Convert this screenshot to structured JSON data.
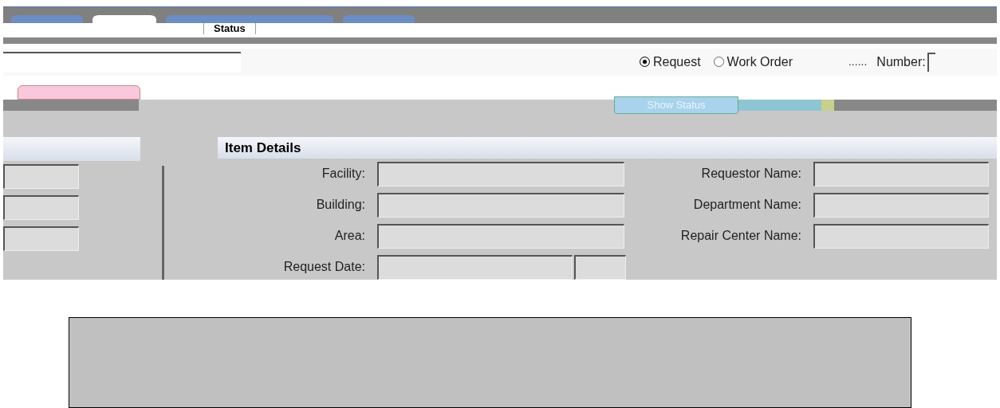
{
  "tabs": [
    {
      "label": "Status",
      "selected": true
    }
  ],
  "search": {
    "mode_options": [
      {
        "label": "Request",
        "selected": true
      },
      {
        "label": "Work Order",
        "selected": false
      }
    ],
    "dots": "......",
    "number_label": "Number:"
  },
  "show_status_button": "Show Status",
  "item_details": {
    "title": "Item Details",
    "left_fields": [
      {
        "label": "Facility:"
      },
      {
        "label": "Building:"
      },
      {
        "label": "Area:"
      },
      {
        "label": "Request Date:"
      }
    ],
    "right_fields": [
      {
        "label": "Requestor Name:"
      },
      {
        "label": "Department Name:"
      },
      {
        "label": "Repair Center Name:"
      }
    ]
  }
}
